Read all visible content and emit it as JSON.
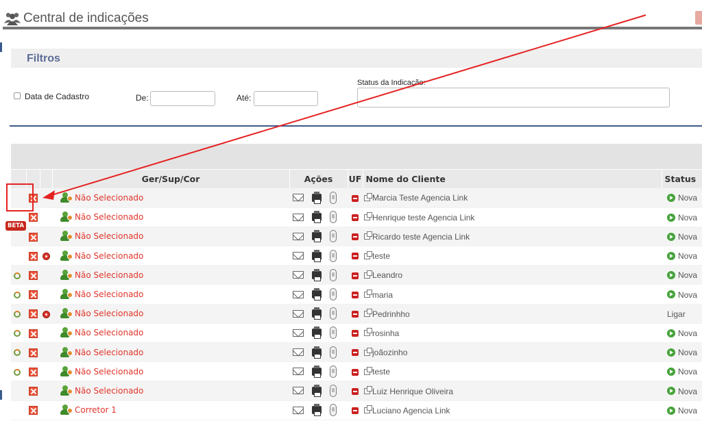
{
  "header": {
    "title": "Central de indicações"
  },
  "filters": {
    "title": "Filtros",
    "checkbox_label": "Data de Cadastro",
    "from_label": "De:",
    "to_label": "Até:",
    "status_label": "Status da Indicação:"
  },
  "table": {
    "columns": [
      "Ger/Sup/Cor",
      "Ações",
      "UF",
      "Nome do Cliente",
      "Status"
    ],
    "rows": [
      {
        "recycle": false,
        "alarm": false,
        "ger": "Não Selecionado",
        "client": "Marcia Teste Agencia Link",
        "status": "Nova",
        "status_icon": true
      },
      {
        "recycle": false,
        "alarm": false,
        "ger": "Não Selecionado",
        "client": "Henrique teste Agencia Link",
        "status": "Nova",
        "status_icon": true
      },
      {
        "recycle": false,
        "alarm": false,
        "ger": "Não Selecionado",
        "client": "Ricardo teste Agencia Link",
        "status": "Nova",
        "status_icon": true
      },
      {
        "recycle": false,
        "alarm": true,
        "ger": "Não Selecionado",
        "client": "teste",
        "status": "Nova",
        "status_icon": true
      },
      {
        "recycle": true,
        "alarm": false,
        "ger": "Não Selecionado",
        "client": "Leandro",
        "status": "Nova",
        "status_icon": true
      },
      {
        "recycle": true,
        "alarm": false,
        "ger": "Não Selecionado",
        "client": "maria",
        "status": "Nova",
        "status_icon": true
      },
      {
        "recycle": true,
        "alarm": true,
        "ger": "Não Selecionado",
        "client": "Pedrinhho",
        "status": "Ligar",
        "status_icon": false
      },
      {
        "recycle": true,
        "alarm": false,
        "ger": "Não Selecionado",
        "client": "rosinha",
        "status": "Nova",
        "status_icon": true
      },
      {
        "recycle": true,
        "alarm": false,
        "ger": "Não Selecionado",
        "client": "joãozinho",
        "status": "Nova",
        "status_icon": true
      },
      {
        "recycle": true,
        "alarm": false,
        "ger": "Não Selecionado",
        "client": "teste",
        "status": "Nova",
        "status_icon": true
      },
      {
        "recycle": false,
        "alarm": false,
        "ger": "Não Selecionado",
        "client": "Luiz Henrique Oliveira",
        "status": "Nova",
        "status_icon": true
      },
      {
        "recycle": false,
        "alarm": false,
        "ger": "Corretor 1",
        "client": "Luciano Agencia Link",
        "status": "Nova",
        "status_icon": true
      }
    ]
  },
  "beta_label": "BETA",
  "colors": {
    "accent": "#e0352b",
    "nav_blue": "#3e5a8a",
    "status_green": "#46a33a"
  },
  "icons": [
    "users-icon",
    "delete-icon",
    "recycle-icon",
    "alarm-icon",
    "person-icon",
    "mail-icon",
    "print-icon",
    "phone-icon",
    "uf-icon",
    "link-icon",
    "status-icon"
  ]
}
